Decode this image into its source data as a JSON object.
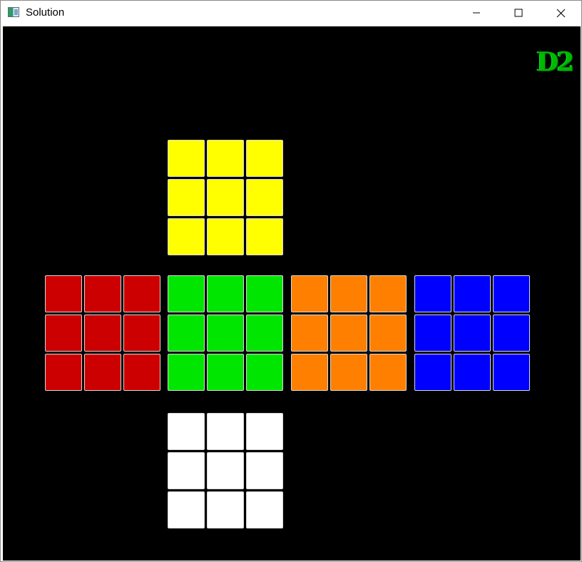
{
  "window": {
    "title": "Solution",
    "icon": "app-window-icon",
    "controls": {
      "minimize_icon": "minimize-icon",
      "maximize_icon": "maximize-icon",
      "close_icon": "close-icon"
    }
  },
  "canvas": {
    "background": "#000000",
    "logo_text": "D2",
    "logo_color": "#00b800"
  },
  "colors": {
    "yellow": "#ffff00",
    "red": "#cc0000",
    "green": "#00e600",
    "orange": "#ff8000",
    "blue": "#0000ff",
    "white": "#ffffff"
  },
  "faces": [
    {
      "name": "top",
      "color": "yellow",
      "stickers": [
        "yellow",
        "yellow",
        "yellow",
        "yellow",
        "yellow",
        "yellow",
        "yellow",
        "yellow",
        "yellow"
      ]
    },
    {
      "name": "left",
      "color": "red",
      "stickers": [
        "red",
        "red",
        "red",
        "red",
        "red",
        "red",
        "red",
        "red",
        "red"
      ]
    },
    {
      "name": "front",
      "color": "green",
      "stickers": [
        "green",
        "green",
        "green",
        "green",
        "green",
        "green",
        "green",
        "green",
        "green"
      ]
    },
    {
      "name": "right",
      "color": "orange",
      "stickers": [
        "orange",
        "orange",
        "orange",
        "orange",
        "orange",
        "orange",
        "orange",
        "orange",
        "orange"
      ]
    },
    {
      "name": "back",
      "color": "blue",
      "stickers": [
        "blue",
        "blue",
        "blue",
        "blue",
        "blue",
        "blue",
        "blue",
        "blue",
        "blue"
      ]
    },
    {
      "name": "bottom",
      "color": "white",
      "stickers": [
        "white",
        "white",
        "white",
        "white",
        "white",
        "white",
        "white",
        "white",
        "white"
      ]
    }
  ]
}
